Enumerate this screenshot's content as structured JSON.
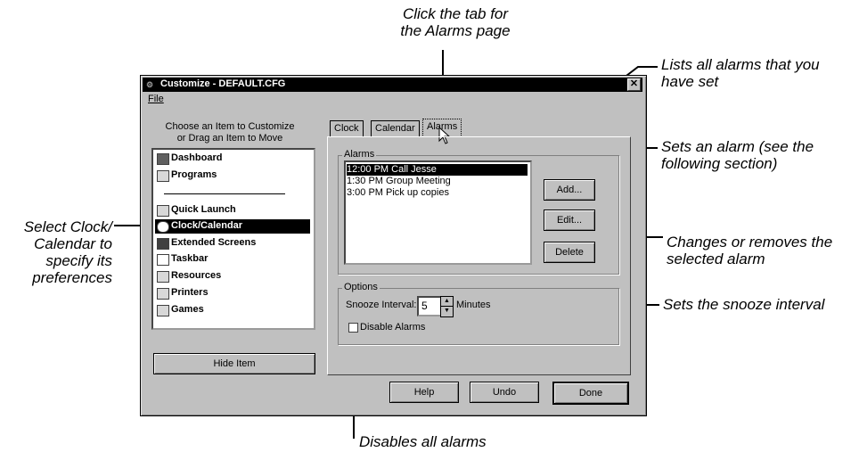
{
  "callouts": {
    "tab_hint": [
      "Click the tab for",
      "the Alarms page"
    ],
    "list_hint": [
      "Lists all alarms that you",
      "have set"
    ],
    "add_hint": [
      "Sets an alarm (see the",
      "following section)"
    ],
    "select_hint": [
      "Select Clock/",
      "Calendar to",
      "specify its",
      "preferences"
    ],
    "edit_delete_hint": [
      "Changes or removes the",
      "selected alarm"
    ],
    "snooze_hint": "Sets the snooze interval",
    "disable_hint": "Disables all alarms"
  },
  "window": {
    "title": "Customize - DEFAULT.CFG",
    "menu_file": "File",
    "close_glyph": "✕"
  },
  "left_panel": {
    "instruction": [
      "Choose an Item to Customize",
      "or Drag an Item to Move"
    ],
    "items": [
      {
        "label": "Dashboard",
        "selected": false
      },
      {
        "label": "Programs",
        "selected": false
      },
      {
        "label": "Quick Launch",
        "selected": false
      },
      {
        "label": "Clock/Calendar",
        "selected": true
      },
      {
        "label": "Extended Screens",
        "selected": false
      },
      {
        "label": "Taskbar",
        "selected": false
      },
      {
        "label": "Resources",
        "selected": false
      },
      {
        "label": "Printers",
        "selected": false
      },
      {
        "label": "Games",
        "selected": false
      }
    ],
    "hide_button": "Hide Item"
  },
  "tabs": [
    "Clock",
    "Calendar",
    "Alarms"
  ],
  "active_tab": "Alarms",
  "alarms": {
    "group_label": "Alarms",
    "list": [
      "12:00 PM Call Jesse",
      "1:30 PM Group Meeting",
      "3:00 PM Pick up copies"
    ],
    "selected_index": 0,
    "add_label": "Add...",
    "edit_label": "Edit...",
    "delete_label": "Delete"
  },
  "options": {
    "group_label": "Options",
    "snooze_label": "Snooze Interval:",
    "snooze_value": "5",
    "minutes_label": "Minutes",
    "disable_label": "Disable Alarms",
    "disable_checked": false
  },
  "footer": {
    "help": "Help",
    "undo": "Undo",
    "done": "Done"
  }
}
